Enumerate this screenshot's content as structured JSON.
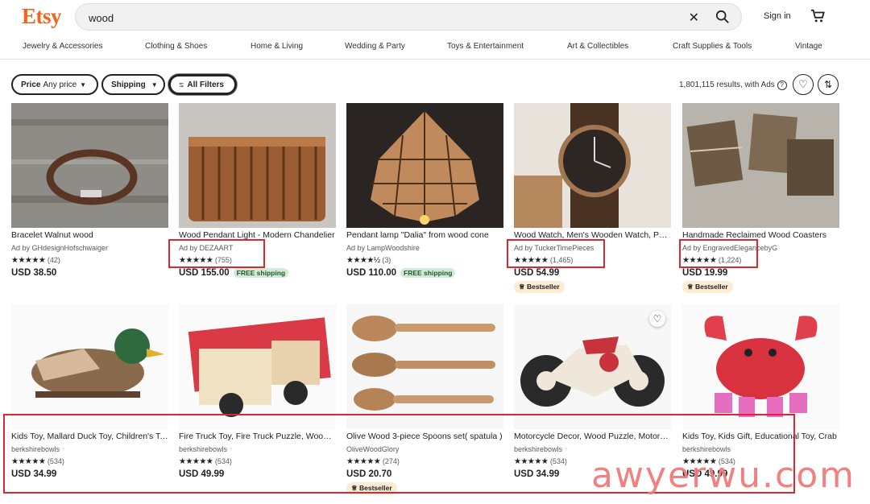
{
  "header": {
    "logo": "Etsy",
    "search_value": "wood",
    "signin": "Sign in",
    "categories": [
      "Jewelry & Accessories",
      "Clothing & Shoes",
      "Home & Living",
      "Wedding & Party",
      "Toys & Entertainment",
      "Art & Collectibles",
      "Craft Supplies & Tools",
      "Vintage"
    ]
  },
  "filters": {
    "price_label": "Price",
    "price_value": "Any price",
    "shipping": "Shipping",
    "all_filters": "All Filters",
    "results": "1,801,115 results, with Ads"
  },
  "products": [
    {
      "title": "Bracelet Walnut wood",
      "shop": "Ad by GHdesignHofschwaiger",
      "stars": "★★★★★",
      "reviews": "(42)",
      "price": "USD 38.50",
      "free": "",
      "badge": ""
    },
    {
      "title": "Wood Pendant Light - Modern Chandelier",
      "shop": "Ad by DEZAART",
      "stars": "★★★★★",
      "reviews": "(755)",
      "price": "USD 155.00",
      "free": "FREE shipping",
      "badge": ""
    },
    {
      "title": "Pendant lamp \"Dalia\" from wood cone",
      "shop": "Ad by LampWoodshire",
      "stars": "★★★★½",
      "reviews": "(3)",
      "price": "USD 110.00",
      "free": "FREE shipping",
      "badge": ""
    },
    {
      "title": "Wood Watch, Men's Wooden Watch, Personalized",
      "shop": "Ad by TuckerTimePieces",
      "stars": "★★★★★",
      "reviews": "(1,465)",
      "price": "USD 54.99",
      "free": "",
      "badge": "Bestseller"
    },
    {
      "title": "Handmade Reclaimed Wood Coasters",
      "shop": "Ad by EngravedElegancebyG",
      "stars": "★★★★★",
      "reviews": "(1,224)",
      "price": "USD 19.99",
      "free": "",
      "badge": "Bestseller"
    },
    {
      "title": "Kids Toy, Mallard Duck Toy, Children's Toy",
      "shop": "berkshirebowls",
      "stars": "★★★★★",
      "reviews": "(534)",
      "price": "USD 34.99",
      "free": "",
      "badge": ""
    },
    {
      "title": "Fire Truck Toy, Fire Truck Puzzle, Wooden Toy",
      "shop": "berkshirebowls",
      "stars": "★★★★★",
      "reviews": "(534)",
      "price": "USD 49.99",
      "free": "",
      "badge": ""
    },
    {
      "title": "Olive Wood 3-piece Spoons set( spatula )",
      "shop": "OliveWoodGlory",
      "stars": "★★★★★",
      "reviews": "(274)",
      "price": "USD 20.70",
      "free": "",
      "badge": "Bestseller"
    },
    {
      "title": "Motorcycle Decor, Wood Puzzle, Motorcycle Toy",
      "shop": "berkshirebowls",
      "stars": "★★★★★",
      "reviews": "(534)",
      "price": "USD 34.99",
      "free": "",
      "badge": ""
    },
    {
      "title": "Kids Toy, Kids Gift, Educational Toy, Crab",
      "shop": "berkshirebowls",
      "stars": "★★★★★",
      "reviews": "(534)",
      "price": "USD 49.99",
      "free": "",
      "badge": ""
    }
  ],
  "watermark": "awyerwu.com",
  "colors": {
    "brand": "#f1641e",
    "annotation": "#d9282f",
    "free_bg": "#d4e9d7",
    "bestseller_bg": "#fdebd2"
  }
}
